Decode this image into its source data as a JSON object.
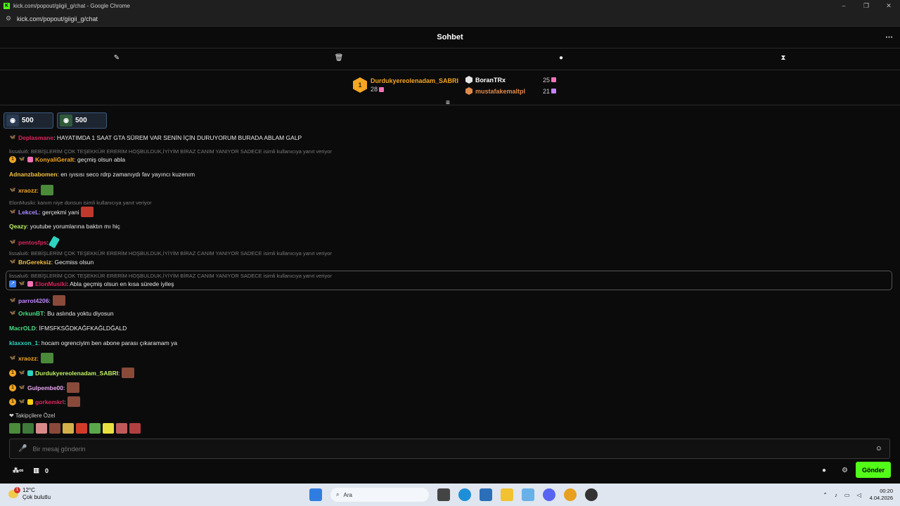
{
  "window": {
    "title": "kick.com/popout/giigii_g/chat - Google Chrome",
    "favicon": "K",
    "url": "kick.com/popout/giigii_g/chat",
    "buttons": [
      "–",
      "❐",
      "✕"
    ]
  },
  "header": {
    "title": "Sohbet",
    "more": "⋯"
  },
  "toolbar": {
    "icons": [
      "pin-icon",
      "trash-icon",
      "chat-bubble-icon",
      "hourglass-icon"
    ]
  },
  "leaderboard": {
    "first": {
      "rank": "1",
      "name": "Durdukyereolenadam_SABRI",
      "count": "28"
    },
    "second": {
      "name": "BoranTRx",
      "count": "25"
    },
    "third": {
      "name": "mustafakemaltpl",
      "count": "21"
    }
  },
  "goals": [
    {
      "value": "500"
    },
    {
      "value": "500"
    }
  ],
  "messages": [
    {
      "user": "Deplasmane",
      "color": "#e0245e",
      "text": ": HAYATIMDA 1 SAAT GTA SÜREM VAR SENİN İÇİN DURUYORUM BURADA ABLAM GALP"
    },
    {
      "reply": "lissalui6: BEBİŞLERİM ÇOK TEŞEKKÜR ERERİM HOŞBULDUK,İYİYİM BİRAZ CANIM YANIYOR SADECE isimli kullanıcıya yanıt veriyor"
    },
    {
      "user": "KonyaliGeralt",
      "color": "#f5a623",
      "text": ": geçmiş olsun abla"
    },
    {
      "user": "Adnanzbabomen",
      "color": "#f0c040",
      "text": ": en ıyısısı seco rdrp zamanıydı fav yayıncı kuzenım"
    },
    {
      "user": "xraozz",
      "color": "#f5a623",
      "text": ":"
    },
    {
      "reply": "ElonMusiki: kanım niye donsun isimli kullanıcıya yanıt veriyor"
    },
    {
      "user": "LekceL",
      "color": "#a78bfa",
      "text": ": gerçekmi yani"
    },
    {
      "user": "Qeazy",
      "color": "#bef264",
      "text": ": youtube yorumlarına baktın mı hiç"
    },
    {
      "user": "pentosfps",
      "color": "#e0245e",
      "text": ":"
    },
    {
      "reply": "lissalui6: BEBİŞLERİM ÇOK TEŞEKKÜR ERERİM HOŞBULDUK,İYİYİM BİRAZ CANIM YANIYOR SADECE isimli kullanıcıya yanıt veriyor"
    },
    {
      "user": "BnGereksiz",
      "color": "#f0c040",
      "text": ": Gecmiss olsun"
    },
    {
      "reply": "lissalui6: BEBİŞLERİM ÇOK TEŞEKKÜR ERERİM HOŞBULDUK,İYİYİM BİRAZ CANIM YANIYOR SADECE isimli kullanıcıya yanıt veriyor"
    },
    {
      "user": "ElonMusiki",
      "color": "#e0245e",
      "text": ": Abla geçmiş olsun en kısa sürede iyileş"
    },
    {
      "user": "parrot4206",
      "color": "#c084fc",
      "text": ":"
    },
    {
      "user": "OrkunBT",
      "color": "#4ade80",
      "text": ": Bu aslında yoktu diyosun"
    },
    {
      "user": "MacrOLD",
      "color": "#4ade80",
      "text": ": İFMSFKSĞDKAĞFKAĞLDĞALD"
    },
    {
      "user": "klaxxon_1",
      "color": "#2dd4bf",
      "text": ": hocam ogrenciyim ben abone parası çıkaramam ya"
    },
    {
      "user": "xraozz",
      "color": "#f5a623",
      "text": ":"
    },
    {
      "user": "Durdukyereolenadam_SABRI",
      "color": "#bef264",
      "text": ":"
    },
    {
      "user": "Gulpembe00",
      "color": "#e9a8f0",
      "text": ":"
    },
    {
      "user": "gorkemkrl",
      "color": "#e0245e",
      "text": ":"
    }
  ],
  "follower_label": "❤ Takipçilere Özel",
  "input": {
    "placeholder": "Bir mesaj gönderin"
  },
  "bottom": {
    "points": "0",
    "send_label": "Gönder"
  },
  "taskbar": {
    "temp": "12°C",
    "weather": "Çok bulutlu",
    "search": "Ara",
    "time": "00:20",
    "date": "4.04.2026"
  }
}
